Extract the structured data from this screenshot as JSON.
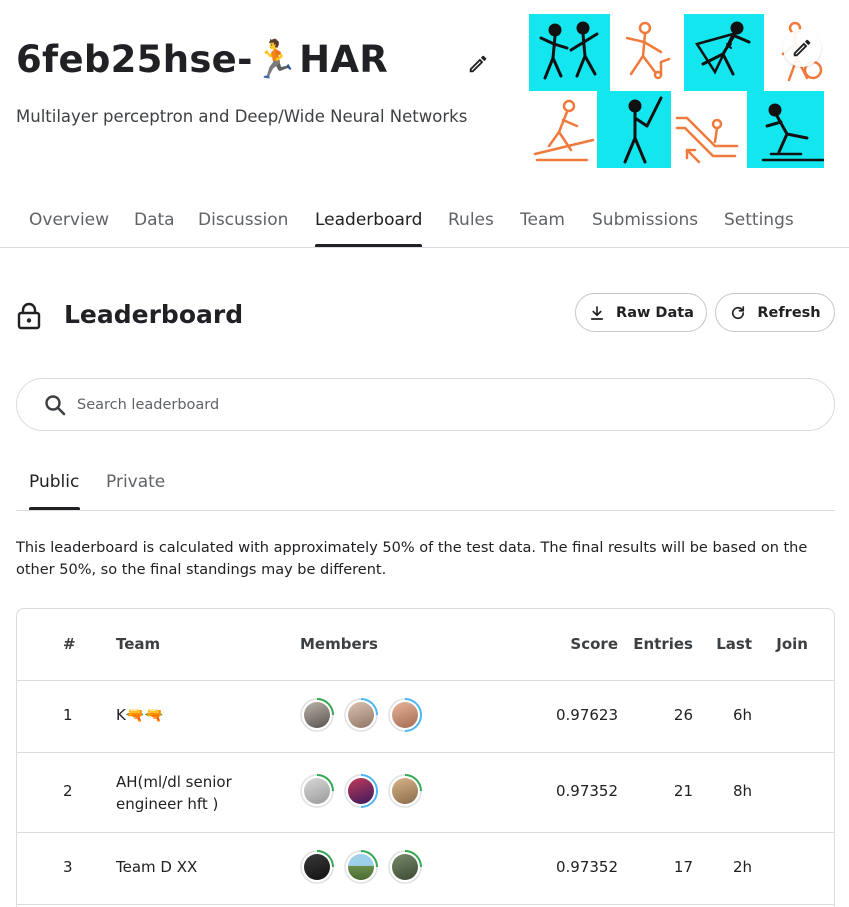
{
  "header": {
    "title": "6feb25hse-🏃HAR",
    "subtitle": "Multilayer perceptron and Deep/Wide Neural Networks"
  },
  "icons": {
    "title_edit": "pencil-icon",
    "banner_edit": "pencil-icon",
    "lock": "lock-icon",
    "search": "search-icon",
    "raw_data": "download-icon",
    "refresh": "refresh-icon"
  },
  "colors": {
    "banner_cyan": "#14e6f0",
    "banner_orange": "#f07a3c",
    "ring_green": "#34a853",
    "ring_blue": "#4db6f5"
  },
  "tabs": [
    {
      "label": "Overview"
    },
    {
      "label": "Data"
    },
    {
      "label": "Discussion"
    },
    {
      "label": "Leaderboard",
      "active": true
    },
    {
      "label": "Rules"
    },
    {
      "label": "Team"
    },
    {
      "label": "Submissions"
    },
    {
      "label": "Settings"
    }
  ],
  "section": {
    "title": "Leaderboard",
    "raw_data_label": "Raw Data",
    "refresh_label": "Refresh"
  },
  "search": {
    "placeholder": "Search leaderboard",
    "value": ""
  },
  "subtabs": [
    {
      "label": "Public",
      "active": true
    },
    {
      "label": "Private"
    }
  ],
  "note": "This leaderboard is calculated with approximately 50% of the test data. The final results will be based on the other 50%, so the final standings may be different.",
  "table": {
    "headers": {
      "rank": "#",
      "team": "Team",
      "members": "Members",
      "score": "Score",
      "entries": "Entries",
      "last": "Last",
      "join": "Join"
    },
    "rows": [
      {
        "rank": "1",
        "team": "K🔫🔫",
        "score": "0.97623",
        "entries": "26",
        "last": "6h",
        "member_count": 3
      },
      {
        "rank": "2",
        "team": "AH(ml/dl senior engineer hft )",
        "score": "0.97352",
        "entries": "21",
        "last": "8h",
        "member_count": 3
      },
      {
        "rank": "3",
        "team": "Team D XX",
        "score": "0.97352",
        "entries": "17",
        "last": "2h",
        "member_count": 3
      }
    ]
  }
}
